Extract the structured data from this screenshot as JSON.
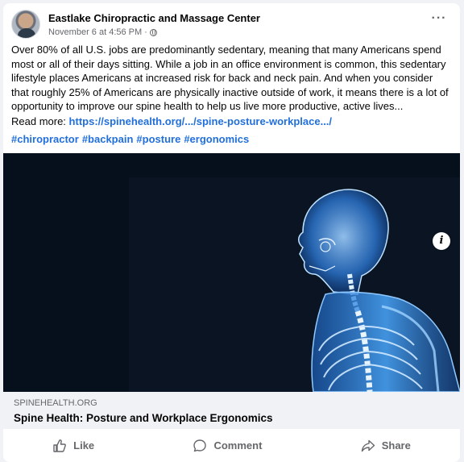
{
  "post": {
    "page_name": "Eastlake Chiropractic and Massage Center",
    "timestamp": "November 6 at 4:56 PM",
    "separator": "·",
    "privacy_icon": "globe-icon",
    "more_label": "···",
    "body": "Over 80% of all U.S. jobs are predominantly sedentary, meaning that many Americans spend most or all of their days sitting. While a job in an office environment is common, this sedentary lifestyle places Americans at increased risk for back and neck pain. And when you consider that roughly 25% of Americans are physically inactive outside of work, it means there is a lot of opportunity to improve our spine health to help us live more productive, active lives...",
    "read_more_label": "Read more:",
    "read_more_url": "https://spinehealth.org/.../spine-posture-workplace.../",
    "hashtags": [
      "#chiropractor",
      "#backpain",
      "#posture",
      "#ergonomics"
    ]
  },
  "link_preview": {
    "domain": "SPINEHEALTH.ORG",
    "title": "Spine Health: Posture and Workplace Ergonomics",
    "info_label": "i"
  },
  "actions": {
    "like": "Like",
    "comment": "Comment",
    "share": "Share"
  },
  "colors": {
    "link": "#216fdb",
    "meta": "#65676b",
    "image_background": "#06101c",
    "skeleton_glow": "#4aa8ff"
  }
}
